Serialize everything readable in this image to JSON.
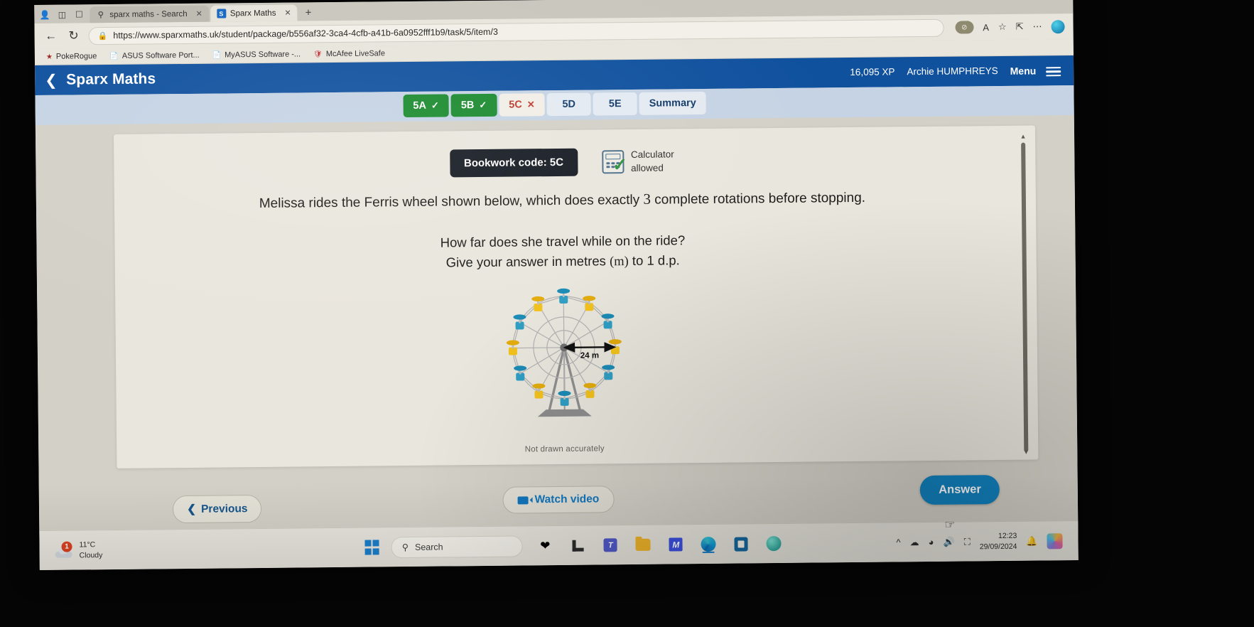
{
  "browser": {
    "tabs": [
      {
        "title": "sparx maths - Search",
        "icon": "search-icon",
        "active": false
      },
      {
        "title": "Sparx Maths",
        "icon": "sparx-favicon",
        "active": true
      }
    ],
    "new_tab_label": "+",
    "back_icon": "back-arrow-icon",
    "reload_icon": "reload-icon",
    "lock_icon": "lock-icon",
    "url": "https://www.sparxmaths.uk/student/package/b556af32-3ca4-4cfb-a41b-6a0952fff1b9/task/5/item/3",
    "toolbar_icons": [
      "read-aloud-icon",
      "favorite-star-icon",
      "collections-icon",
      "more-options-icon",
      "profile-avatar-icon"
    ],
    "read_aloud_label": "A",
    "more_label": "⋯",
    "bookmarks": [
      {
        "label": "PokeRogue",
        "icon": "pokerogue-icon"
      },
      {
        "label": "ASUS Software Port...",
        "icon": "page-icon"
      },
      {
        "label": "MyASUS Software -...",
        "icon": "page-icon"
      },
      {
        "label": "McAfee LiveSafe",
        "icon": "mcafee-shield-icon"
      }
    ]
  },
  "app": {
    "back_icon": "chevron-left-icon",
    "title": "Sparx Maths",
    "xp": "16,095 XP",
    "user": "Archie HUMPHREYS",
    "menu_label": "Menu",
    "menu_icon": "hamburger-icon",
    "header_color": "#10519e"
  },
  "question_tabs": [
    {
      "label": "5A",
      "mark": "✓",
      "state": "done"
    },
    {
      "label": "5B",
      "mark": "✓",
      "state": "done"
    },
    {
      "label": "5C",
      "mark": "✕",
      "state": "active"
    },
    {
      "label": "5D",
      "mark": "",
      "state": "todo"
    },
    {
      "label": "5E",
      "mark": "",
      "state": "todo"
    },
    {
      "label": "Summary",
      "mark": "",
      "state": "todo"
    }
  ],
  "question": {
    "bookwork_code": "Bookwork code: 5C",
    "calculator_line1": "Calculator",
    "calculator_line2": "allowed",
    "calculator_icon": "calculator-icon",
    "check_icon": "green-check-icon",
    "prompt_main": "Melissa rides the Ferris wheel shown below, which does exactly",
    "prompt_number": "3",
    "prompt_main_end": "complete rotations before stopping.",
    "prompt_line2": "How far does she travel while on the ride?",
    "prompt_line3_a": "Give your answer in metres",
    "prompt_line3_unit": "(m)",
    "prompt_line3_b": "to 1 d.p.",
    "figure_caption": "Not drawn accurately",
    "diagram": {
      "name": "ferris-wheel-diagram",
      "radius_label": "24 m",
      "radius_value": 24,
      "cabin_count": 12,
      "cabin_colors": [
        "#2f9ec4",
        "#f2c21c"
      ],
      "base_color": "#8f8f8f"
    }
  },
  "actions": {
    "previous_label": "Previous",
    "previous_icon": "chevron-left-icon",
    "watch_video_label": "Watch video",
    "watch_video_icon": "video-camera-icon",
    "answer_label": "Answer",
    "answer_color": "#1282bf"
  },
  "taskbar": {
    "weather_temp": "11°C",
    "weather_desc": "Cloudy",
    "weather_badge": "1",
    "weather_icon": "cloud-icon",
    "start_icon": "windows-start-icon",
    "search_placeholder": "Search",
    "search_icon": "search-icon",
    "apps": [
      "health-icon",
      "l-app-icon",
      "microsoft-teams-icon",
      "file-explorer-icon",
      "mm-app-icon",
      "microsoft-edge-icon",
      "microsoft-store-icon",
      "app-icon"
    ],
    "tray_icons": [
      "show-hidden-icons-icon",
      "onedrive-icon",
      "wifi-icon",
      "volume-icon",
      "battery-icon"
    ],
    "time": "12:23",
    "date": "29/09/2024",
    "notification_icon": "bell-icon",
    "avatar_icon": "user-avatar-icon"
  }
}
